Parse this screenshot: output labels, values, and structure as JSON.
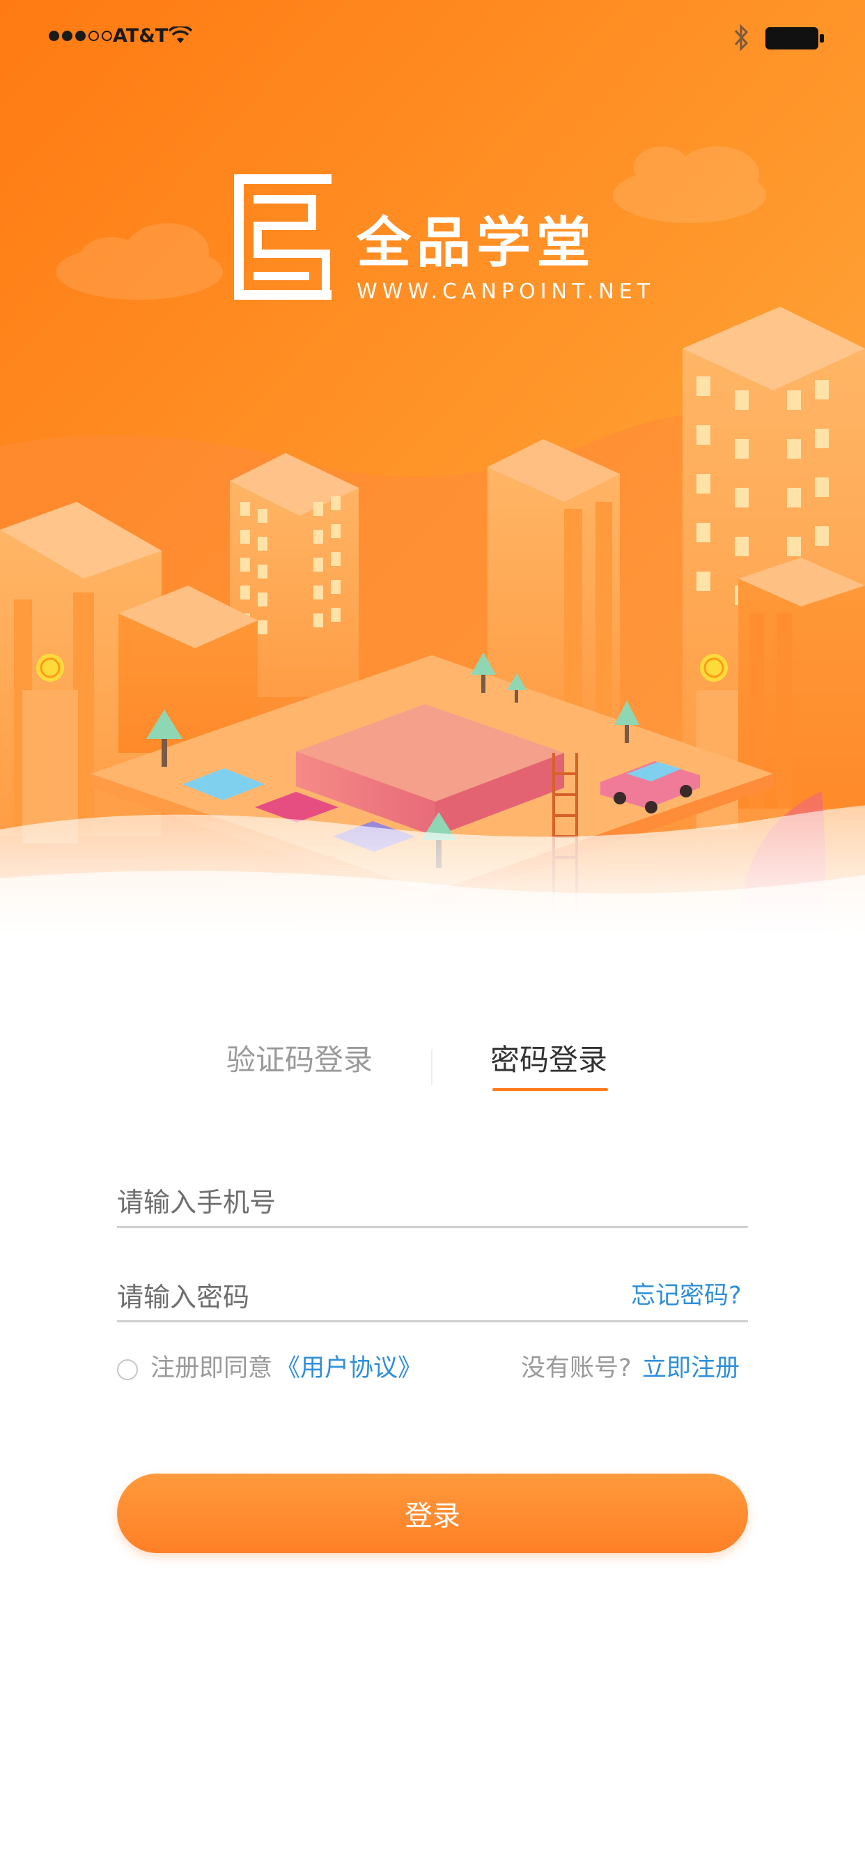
{
  "status_bar": {
    "carrier": "AT&T",
    "signal_bars_filled": 3,
    "signal_bars_total": 5,
    "icons": [
      "wifi-icon",
      "bluetooth-icon",
      "battery-icon"
    ]
  },
  "brand": {
    "name": "全品学堂",
    "url": "WWW.CANPOINT.NET",
    "logo_icon": "canpoint-logo-icon"
  },
  "tabs": [
    {
      "label": "验证码登录",
      "active": false
    },
    {
      "label": "密码登录",
      "active": true
    }
  ],
  "form": {
    "phone_placeholder": "请输入手机号",
    "password_placeholder": "请输入密码",
    "forgot_label": "忘记密码?",
    "agree_text": "注册即同意",
    "agree_link": "《用户协议》",
    "no_account_text": "没有账号?",
    "register_link": "立即注册",
    "login_label": "登录"
  },
  "colors": {
    "accent": "#ff7a1c",
    "link": "#2f8fd8",
    "hero_top": "#ff8a1a",
    "hero_bottom": "#ffb45a"
  }
}
